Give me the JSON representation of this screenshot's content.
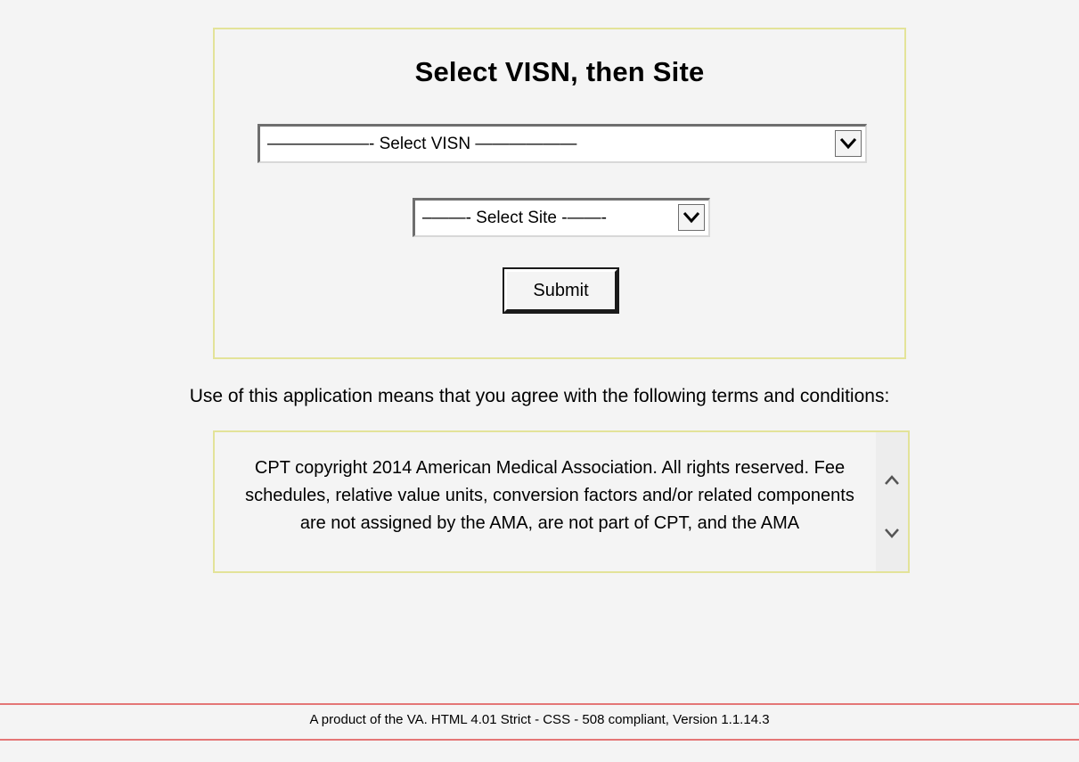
{
  "panel": {
    "title": "Select VISN, then Site"
  },
  "visn_select": {
    "selected": "——————- Select VISN ——————"
  },
  "site_select": {
    "selected": "–——- Select Site -——-"
  },
  "submit": {
    "label": "Submit"
  },
  "terms": {
    "intro": "Use of this application means that you agree with the following terms and conditions:",
    "text": "CPT copyright 2014 American Medical Association. All rights reserved. Fee schedules, relative value units, conversion factors and/or related components are not assigned by the AMA, are not part of CPT, and the AMA"
  },
  "footer": {
    "text": "A product of the VA. HTML 4.01 Strict - CSS - 508 compliant, Version 1.1.14.3"
  },
  "colors": {
    "background": "#f4f4f4",
    "panel_border": "#e3e399",
    "footer_rule": "#e47676"
  },
  "icons": {
    "dropdown": "chevron-down-icon",
    "scroll_up": "chevron-up-icon",
    "scroll_down": "chevron-down-icon"
  }
}
